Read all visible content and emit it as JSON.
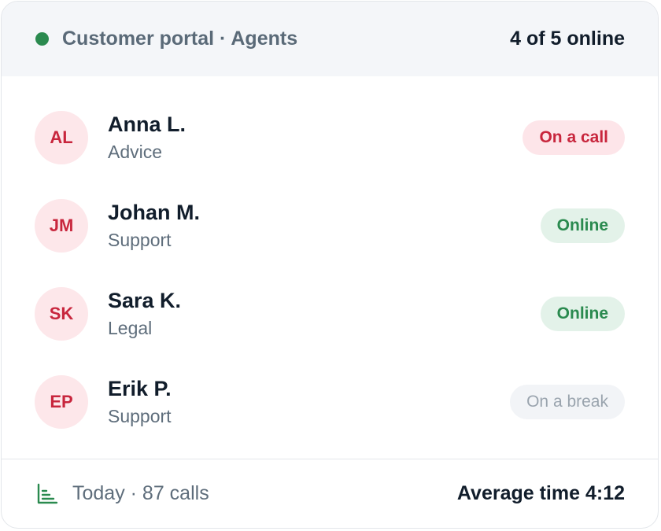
{
  "header": {
    "title": "Customer portal · Agents",
    "online_count": "4 of 5 online"
  },
  "agents": [
    {
      "initials": "AL",
      "name": "Anna L.",
      "role": "Advice",
      "status": "On a call",
      "status_kind": "call"
    },
    {
      "initials": "JM",
      "name": "Johan M.",
      "role": "Support",
      "status": "Online",
      "status_kind": "online"
    },
    {
      "initials": "SK",
      "name": "Sara K.",
      "role": "Legal",
      "status": "Online",
      "status_kind": "online"
    },
    {
      "initials": "EP",
      "name": "Erik P.",
      "role": "Support",
      "status": "On a break",
      "status_kind": "break"
    }
  ],
  "footer": {
    "stats": "Today · 87 calls",
    "average": "Average time 4:12",
    "icon": "bar-chart-icon"
  },
  "colors": {
    "online": "#2a8a4f",
    "call": "#c8263d",
    "break": "#9aa4ae"
  }
}
